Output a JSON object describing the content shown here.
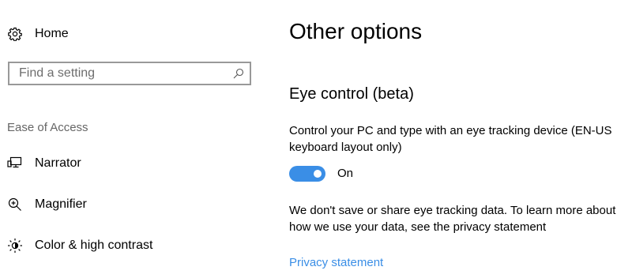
{
  "sidebar": {
    "home_label": "Home",
    "search": {
      "placeholder": "Find a setting",
      "value": ""
    },
    "section_heading": "Ease of Access",
    "items": [
      {
        "label": "Narrator",
        "icon": "narrator-icon"
      },
      {
        "label": "Magnifier",
        "icon": "magnifier-icon"
      },
      {
        "label": "Color & high contrast",
        "icon": "brightness-icon"
      }
    ]
  },
  "main": {
    "title": "Other options",
    "group_title": "Eye control (beta)",
    "description_1": "Control your PC and type with an eye tracking device (EN-US keyboard layout only)",
    "toggle": {
      "state": "On",
      "on": true
    },
    "description_2": "We don't save or share eye tracking data. To learn more about how we use your data, see the privacy statement",
    "link_label": "Privacy statement"
  },
  "colors": {
    "accent": "#3a8ee6",
    "section_heading": "#666666",
    "search_border": "#999999"
  }
}
